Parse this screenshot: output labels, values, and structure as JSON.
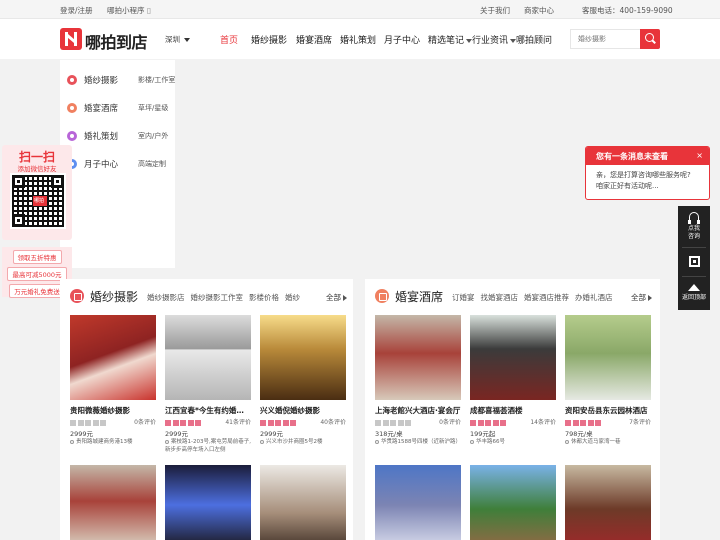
{
  "topbar": {
    "login": "登录/注册",
    "miniapp": "哪拍小程序",
    "about": "关于我们",
    "merchant": "商家中心",
    "phone": "客服电话：400-159-9090"
  },
  "header": {
    "logo_text": "哪拍到店",
    "city": "深圳",
    "nav": [
      {
        "label": "首页"
      },
      {
        "label": "婚纱摄影"
      },
      {
        "label": "婚宴酒席"
      },
      {
        "label": "婚礼策划"
      },
      {
        "label": "月子中心"
      },
      {
        "label": "精选笔记"
      },
      {
        "label": "行业资讯"
      },
      {
        "label": "哪拍顾问"
      }
    ],
    "search_placeholder": "婚纱摄影"
  },
  "dropdown": [
    {
      "name": "婚纱摄影",
      "sub": "影楼/工作室",
      "color": "#e8525a"
    },
    {
      "name": "婚宴酒席",
      "sub": "草坪/星级",
      "color": "#f08060"
    },
    {
      "name": "婚礼策划",
      "sub": "室内/户外",
      "color": "#b865d8"
    },
    {
      "name": "月子中心",
      "sub": "高端定制",
      "color": "#5e8ef0"
    }
  ],
  "qr_panel": {
    "title": "扫一扫",
    "subtitle": "添加微信好友",
    "center_label": "哪拍",
    "promos": [
      "领取五折特惠",
      "最高可减5000元",
      "万元婚礼免费送"
    ]
  },
  "message": {
    "title": "您有一条消息未查看",
    "close": "×",
    "line1": "亲，您是打算咨询哪些服务呢?",
    "line2": "咱家正好有活动呢..."
  },
  "float_sidebar": {
    "consult": "点我",
    "consult2": "咨询",
    "top": "返回顶部"
  },
  "sections": {
    "photo": {
      "title": "婚纱摄影",
      "tags": [
        "婚纱摄影店",
        "婚纱摄影工作室",
        "影楼价格",
        "婚纱"
      ],
      "all": "全部",
      "accent": "#e8525a",
      "cards": [
        {
          "title": "贵阳微薇婚纱摄影",
          "reviews": "0条评价",
          "price": "2999元",
          "addr": "贵阳路城建商务港13楼",
          "stars": "grey"
        },
        {
          "title": "江西宜春*今生有约婚纱摄影",
          "reviews": "41条评价",
          "price": "2999元",
          "addr": "案枝路1-203号,案屯劳局前巷子,新步步高停车场入口左侧",
          "stars": "pink"
        },
        {
          "title": "兴义婚倪婚纱摄影",
          "reviews": "40条评价",
          "price": "2999元",
          "addr": "兴义市沙井商圈5号2楼",
          "stars": "pink"
        }
      ]
    },
    "banquet": {
      "title": "婚宴酒席",
      "tags": [
        "订婚宴",
        "找婚宴酒店",
        "婚宴酒店推荐",
        "办婚礼酒店"
      ],
      "all": "全部",
      "accent": "#f08060",
      "cards": [
        {
          "title": "上海老館兴大酒店·宴会厅",
          "reviews": "0条评价",
          "price": "318元/桌",
          "addr": "华贯路1588号四楼（近新沪路）",
          "stars": "grey"
        },
        {
          "title": "成都喜福荟酒楼",
          "reviews": "14条评价",
          "price": "199元起",
          "addr": "华丰路66号",
          "stars": "pink"
        },
        {
          "title": "资阳安岳县东云园林酒店",
          "reviews": "7条评价",
          "price": "798元/桌",
          "addr": "休都大道马家湾一巷",
          "stars": "pink"
        }
      ]
    }
  }
}
